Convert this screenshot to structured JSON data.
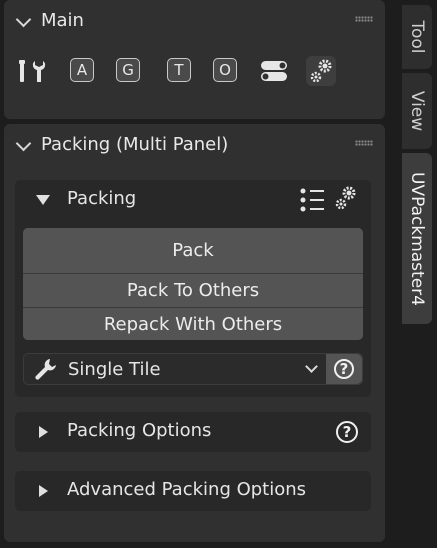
{
  "main_panel": {
    "title": "Main",
    "buttons": [
      "A",
      "G",
      "T",
      "O"
    ]
  },
  "packing_panel": {
    "title": "Packing (Multi Panel)",
    "packing_section": {
      "title": "Packing",
      "pack_label": "Pack",
      "pack_to_others_label": "Pack To Others",
      "repack_with_others_label": "Repack With Others",
      "mode_dropdown": {
        "value": "Single Tile"
      },
      "help_icon": "help-icon"
    },
    "packing_options": {
      "title": "Packing Options",
      "help_icon": "help-icon"
    },
    "advanced_packing_options": {
      "title": "Advanced Packing Options"
    }
  },
  "side_tabs": [
    "Tool",
    "View",
    "UVPackmaster4"
  ],
  "active_tab": "UVPackmaster4",
  "colors": {
    "background": "#1d1d1d",
    "panel": "#303030",
    "button": "#545454",
    "text": "#e6e6e6"
  }
}
